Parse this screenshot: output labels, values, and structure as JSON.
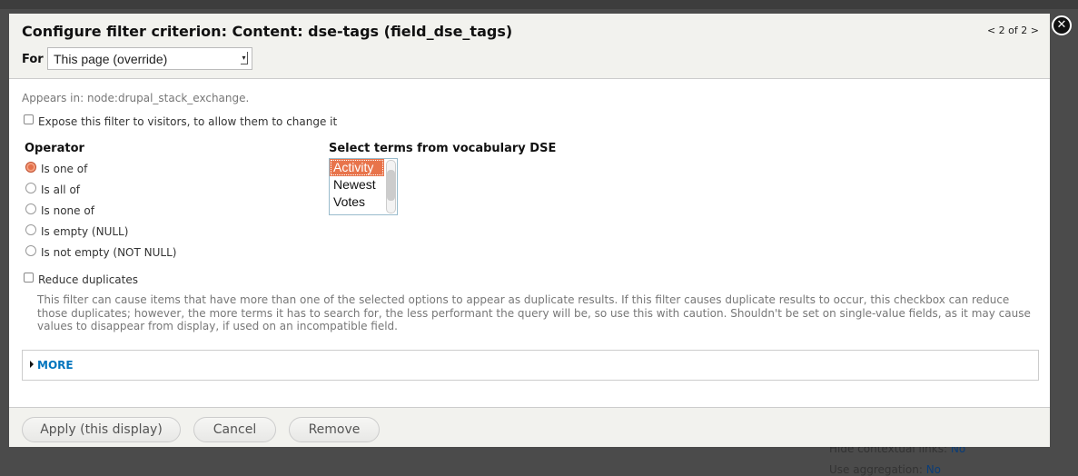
{
  "background": {
    "rows": [
      {
        "label": "Hide contextual links:",
        "value": "No"
      },
      {
        "label": "Use aggregation:",
        "value": "No"
      }
    ]
  },
  "dialog": {
    "title": "Configure filter criterion: Content: dse-tags (field_dse_tags)",
    "pager": "< 2 of 2 >",
    "for_label": "For",
    "for_value": "This page (override)",
    "close_icon": "close-icon",
    "appears_in": "Appears in: node:drupal_stack_exchange.",
    "expose_label": "Expose this filter to visitors, to allow them to change it",
    "operator": {
      "heading": "Operator",
      "selected": "Is one of",
      "options": [
        "Is one of",
        "Is all of",
        "Is none of",
        "Is empty (NULL)",
        "Is not empty (NOT NULL)"
      ]
    },
    "terms": {
      "heading": "Select terms from vocabulary DSE",
      "options": [
        "Activity",
        "Newest",
        "Votes"
      ],
      "selected": [
        "Activity"
      ]
    },
    "reduce_label": "Reduce duplicates",
    "reduce_desc": "This filter can cause items that have more than one of the selected options to appear as duplicate results. If this filter causes duplicate results to occur, this checkbox can reduce those duplicates; however, the more terms it has to search for, the less performant the query will be, so use this with caution. Shouldn't be set on single-value fields, as it may cause values to disappear from display, if used on an incompatible field.",
    "more_label": "MORE",
    "buttons": {
      "apply": "Apply (this display)",
      "cancel": "Cancel",
      "remove": "Remove"
    },
    "colors": {
      "accent": "#e8744b",
      "link": "#0074bd"
    }
  }
}
